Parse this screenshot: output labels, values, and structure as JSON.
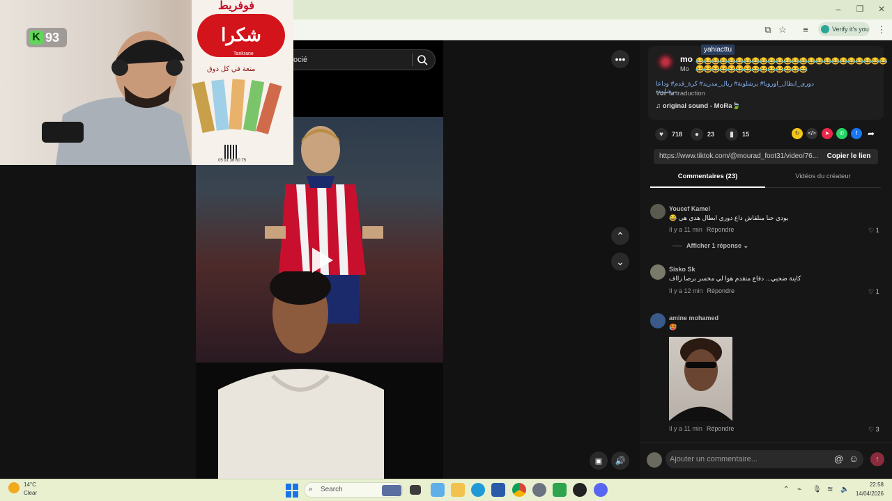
{
  "browser": {
    "verify_label": "Verify it's you",
    "window_controls": [
      "minimize-icon",
      "restore-icon",
      "close-icon"
    ]
  },
  "search": {
    "text": "ocié"
  },
  "overlay": {
    "webcam_badge_letter": "K",
    "webcam_badge_count": "93",
    "ad_brand": "شكرا",
    "ad_small": "Tankrane",
    "ad_top": "فوفريط",
    "ad_tagline": "متعة في كل ذوق",
    "ad_phone": "05 91 36 60 75"
  },
  "post": {
    "author_handle": "mo",
    "author_sub": "Mo",
    "tooltip": "yahiacttu",
    "emoji_line1": "😂😂😂😂😂😂😂😂😂😂😂😂😂😂😂😂😂😂😂😂😂😂😂😂😂😂😂😂😂😂😂",
    "emoji_line2": "😂😂😂😂😂😂😂😂😂😂😂😂😂😂",
    "hashtags": "دوري_ابطال_اوروبا# برشلونة# ريال_مدريد# كرة_قدم# وداعا برشلونة",
    "translate": "Voir la traduction",
    "sound": "original sound - MoRa🍃",
    "likes": "718",
    "comments": "23",
    "saves": "15",
    "link": "https://www.tiktok.com/@mourad_foot31/video/76...",
    "copy_label": "Copier le lien"
  },
  "tabs": {
    "comments": "Commentaires (23)",
    "creator_videos": "Vidéos du créateur"
  },
  "comments": [
    {
      "name": "Youcef Kamel",
      "text": "😂 يودي حنا منلقاش داع دوري ابطال هدي هي",
      "time": "Il y a 11 min",
      "reply": "Répondre",
      "likes": "1"
    },
    {
      "name": "Sisko Sk",
      "text": "كاينة ضحبي... دفاع متقدم هوا لي مخسر برصا زااف",
      "time": "Il y a 12 min",
      "reply": "Répondre",
      "likes": "1"
    },
    {
      "name": "amine mohamed",
      "text": "🥵",
      "time": "Il y a 11 min",
      "reply": "Répondre",
      "likes": "3"
    }
  ],
  "replies_toggle": "Afficher 1 réponse",
  "comment_input_placeholder": "Ajouter un commentaire...",
  "taskbar": {
    "weather_temp": "14°C",
    "weather_cond": "Clear",
    "search_label": "Search",
    "time": "22:58",
    "date": "14/04/2026"
  },
  "colors": {
    "accent": "#8ab4f8",
    "send": "#8a2c3b",
    "taskbar": "#e8f0d0"
  }
}
